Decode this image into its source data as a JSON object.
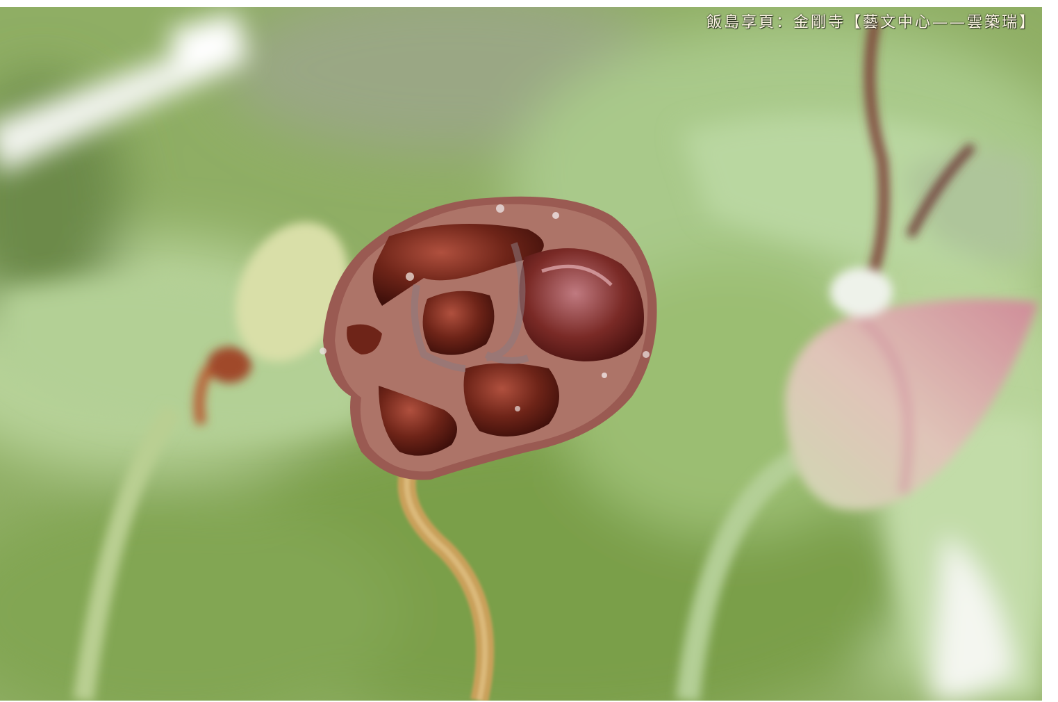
{
  "photo": {
    "watermark": "飯島享頁：金剛寺【藝文中心——雲築瑞】",
    "subject_icon": "lotus-seed-pod",
    "colors": {
      "background_green": "#8fae64",
      "leaf_green": "#b5cf8c",
      "pod_rim": "#9a5a52",
      "pod_cavity": "#5e1c14",
      "bud_pink": "#d79aa2",
      "stem_tan": "#c9a05a",
      "caption_color": "#fff8e6"
    }
  }
}
